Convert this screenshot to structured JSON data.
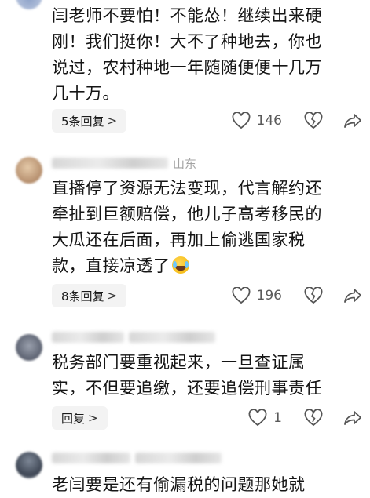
{
  "comments": [
    {
      "location": "",
      "lines": [
        "闫老师不要怕！不能怂！继续出来硬",
        "刚！我们挺你！大不了种地去，你也",
        "说过，农村种地一年随随便便十几万",
        "几十万。"
      ],
      "reply_label": "5条回复",
      "likes": "146"
    },
    {
      "location": "山东",
      "lines": [
        "直播停了资源无法变现，代言解约还",
        "牵扯到巨额赔偿，他儿子高考移民的",
        "大瓜还在后面，再加上偷逃国家税",
        "款，直接凉透了"
      ],
      "reply_label": "8条回复",
      "likes": "196"
    },
    {
      "location": "",
      "lines": [
        "税务部门要重视起来，一旦查证属",
        "实，不但要追缴，还要追偿刑事责任"
      ],
      "reply_label": "回复",
      "likes": "1"
    },
    {
      "location": "",
      "lines": [
        "老闫要是还有偷漏税的问题那她就"
      ],
      "reply_label": "",
      "likes": ""
    }
  ],
  "icons": {
    "like": "heart-outline-icon",
    "dislike": "broken-heart-icon",
    "share": "share-arrow-icon",
    "reply_chevron": "chevron-right-icon",
    "emoji": "laughing-crying-emoji-icon"
  },
  "colors": {
    "text": "#151515",
    "muted": "#a3a3a3",
    "button_bg": "#f3f3f3",
    "icon": "#555555"
  }
}
